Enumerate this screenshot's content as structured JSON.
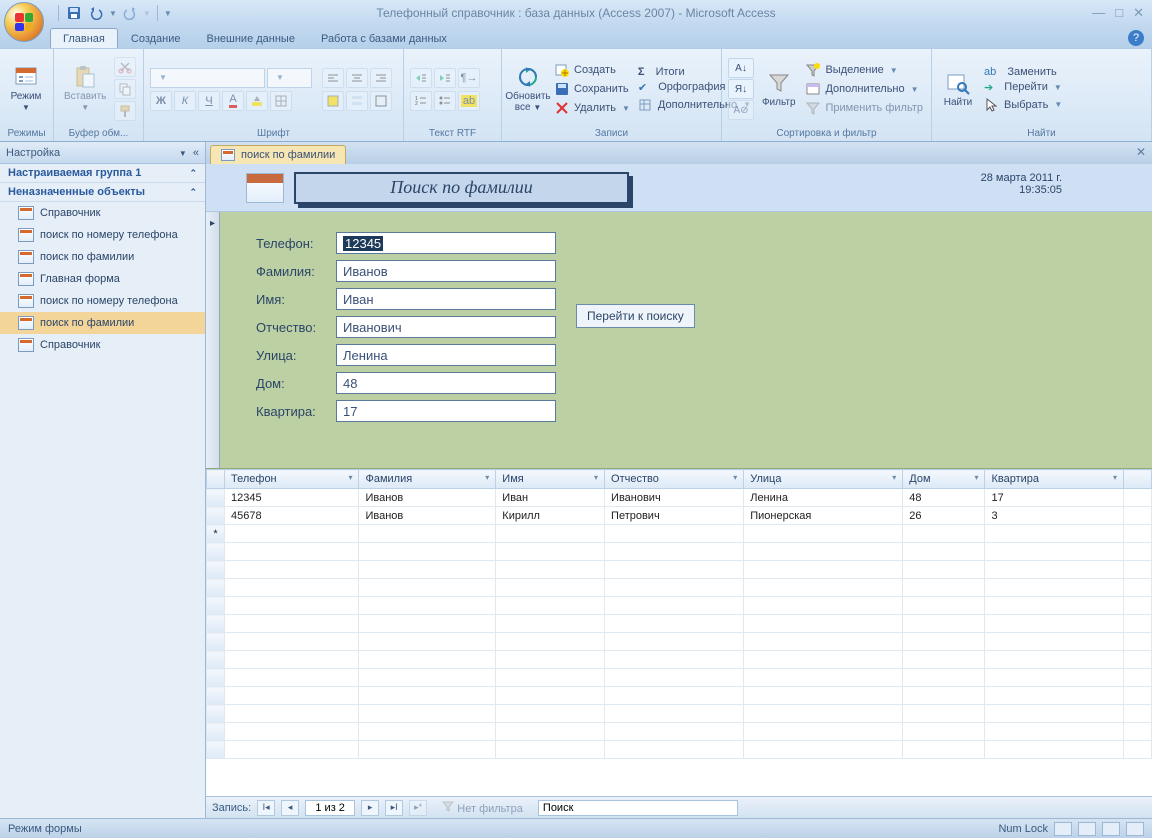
{
  "titlebar": {
    "title": "Телефонный справочник : база данных (Access 2007) - Microsoft Access"
  },
  "tabs": {
    "home": "Главная",
    "create": "Создание",
    "external": "Внешние данные",
    "dbtools": "Работа с базами данных"
  },
  "ribbon": {
    "views": {
      "view": "Режим",
      "group": "Режимы"
    },
    "clipboard": {
      "paste": "Вставить",
      "group": "Буфер обм..."
    },
    "font": {
      "group": "Шрифт"
    },
    "richtext": {
      "group": "Текст RTF"
    },
    "records": {
      "refresh": "Обновить все",
      "new": "Создать",
      "save": "Сохранить",
      "delete": "Удалить",
      "totals": "Итоги",
      "spelling": "Орфография",
      "more": "Дополнительно",
      "group": "Записи"
    },
    "sortfilter": {
      "filter": "Фильтр",
      "selection": "Выделение",
      "advanced": "Дополнительно",
      "toggle": "Применить фильтр",
      "group": "Сортировка и фильтр"
    },
    "find": {
      "find": "Найти",
      "replace": "Заменить",
      "goto": "Перейти",
      "select": "Выбрать",
      "group": "Найти"
    }
  },
  "nav": {
    "header": "Настройка",
    "group1": "Настраиваемая группа 1",
    "group2": "Неназначенные объекты",
    "items": [
      "Справочник",
      "поиск по номеру телефона",
      "поиск по фамилии",
      "Главная форма",
      "поиск по номеру телефона",
      "поиск по фамилии",
      "Справочник"
    ]
  },
  "doc": {
    "tab": "поиск по фамилии",
    "title": "Поиск по фамилии",
    "date": "28 марта 2011 г.",
    "time": "19:35:05",
    "go": "Перейти к поиску",
    "fields": {
      "phone_lbl": "Телефон:",
      "phone": "12345",
      "lname_lbl": "Фамилия:",
      "lname": "Иванов",
      "fname_lbl": "Имя:",
      "fname": "Иван",
      "mname_lbl": "Отчество:",
      "mname": "Иванович",
      "street_lbl": "Улица:",
      "street": "Ленина",
      "house_lbl": "Дом:",
      "house": "48",
      "apt_lbl": "Квартира:",
      "apt": "17"
    },
    "grid": {
      "headers": [
        "Телефон",
        "Фамилия",
        "Имя",
        "Отчество",
        "Улица",
        "Дом",
        "Квартира"
      ],
      "rows": [
        [
          "12345",
          "Иванов",
          "Иван",
          "Иванович",
          "Ленина",
          "48",
          "17"
        ],
        [
          "45678",
          "Иванов",
          "Кирилл",
          "Петрович",
          "Пионерская",
          "26",
          "3"
        ]
      ]
    }
  },
  "recnav": {
    "label": "Запись:",
    "pos": "1 из 2",
    "nofilter": "Нет фильтра",
    "search": "Поиск"
  },
  "status": {
    "mode": "Режим формы",
    "numlock": "Num Lock"
  }
}
